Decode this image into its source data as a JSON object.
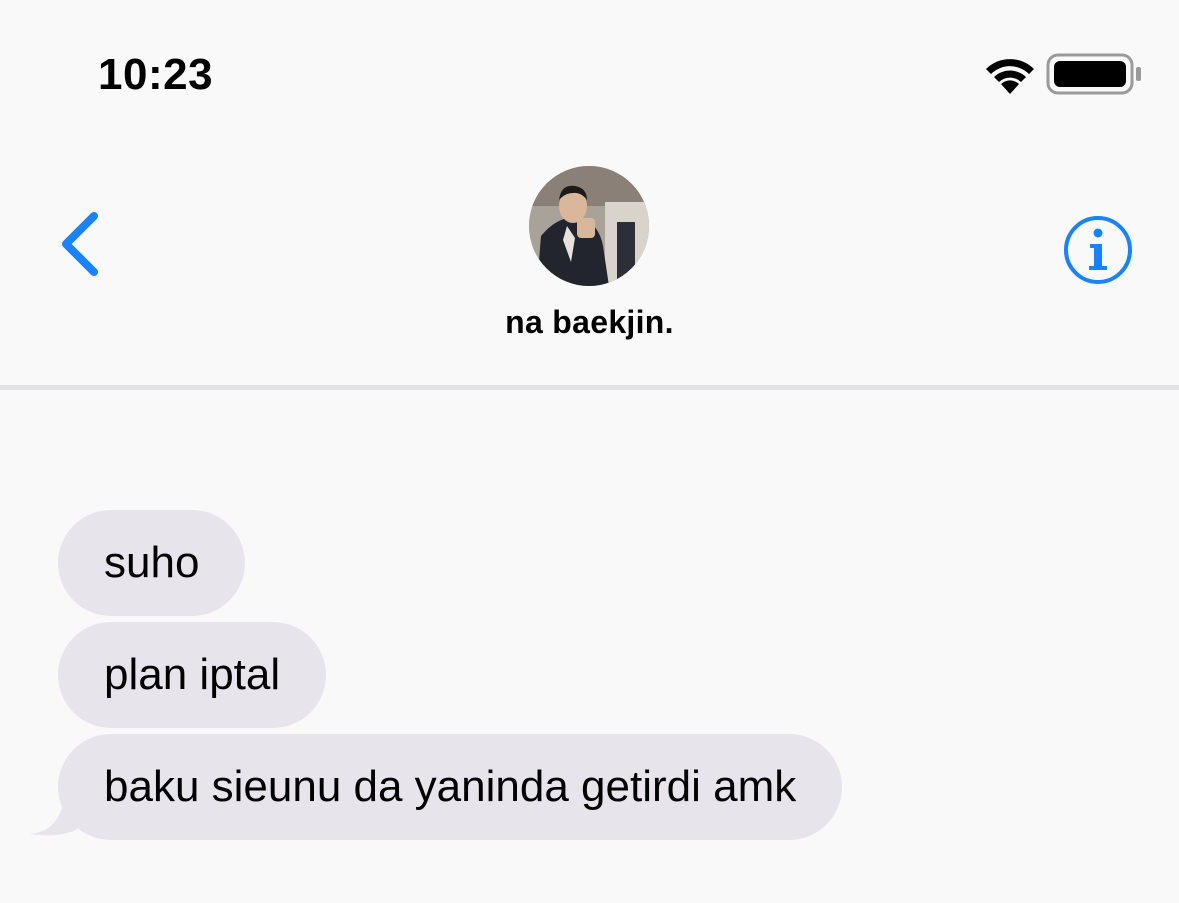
{
  "status_bar": {
    "time": "10:23",
    "icons": [
      "wifi-icon",
      "battery-icon"
    ]
  },
  "header": {
    "contact_name": "na baekjin.",
    "back_icon": "chevron-left-icon",
    "info_icon": "info-icon",
    "accent_color": "#1a82fb"
  },
  "messages": [
    {
      "direction": "incoming",
      "text": "suho"
    },
    {
      "direction": "incoming",
      "text": "plan iptal"
    },
    {
      "direction": "incoming",
      "text": "baku sieunu da yaninda getirdi amk"
    }
  ],
  "colors": {
    "background": "#f9f9f9",
    "incoming_bubble": "#e7e5eb",
    "divider": "#e2e1e6"
  }
}
